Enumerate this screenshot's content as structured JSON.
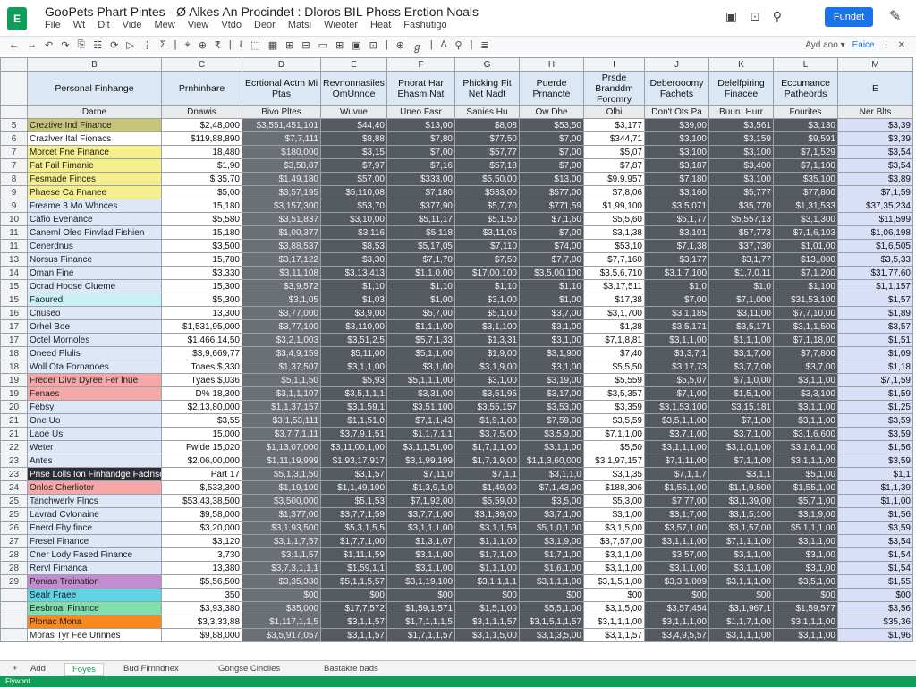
{
  "app": {
    "logo": "E",
    "title": "GooPets Phart Pintes - Ø Alkes An Procindet : Dloros BIL Phoss Erction Noals"
  },
  "menu": [
    "File",
    "Wt",
    "Dit",
    "Vide",
    "Mew",
    "View",
    "Vtdo",
    "Deor",
    "Matsi",
    "Wieoter",
    "Heat",
    "Fashutigo"
  ],
  "title_icons": [
    "comment-icon",
    "lock-icon",
    "present-icon"
  ],
  "share_label": "Fundet",
  "toolbar": {
    "items": [
      "←",
      "→",
      "↶",
      "↷",
      "⎘",
      "☷",
      "⟳",
      "▷",
      "⋮",
      "Σ",
      "|",
      "⌖",
      "⊕",
      "₹",
      "|",
      "ℓ",
      "⬚",
      "▦",
      "⊞",
      "⊟",
      "▭",
      "⊞",
      "▣",
      "⊡",
      "|",
      "⊕",
      "ℊ",
      "|",
      "∆",
      "⚲",
      "|",
      "≣"
    ],
    "right_text": "Ayd aoo ▾",
    "right_blue": "Eaice",
    "right_icons": [
      "⋮",
      "✕"
    ]
  },
  "col_letters": [
    "",
    "B",
    "C",
    "D",
    "E",
    "F",
    "G",
    "H",
    "I",
    "J",
    "K",
    "L",
    "M",
    "E"
  ],
  "cat_headers": [
    "",
    "Personal Finhange",
    "Prnhinhare",
    "Ecrtional\nActm Mi Ptas",
    "Revnonnasiles\nOmUnnoe",
    "Pnorat\nHar\nEhasm Nat",
    "Phicking Fit\nNet\nNadt",
    "Puerde\nPrnancte",
    "Prsde\nBranddm\nForomry",
    "Deberooomy\nFachets",
    "Delelfpiring\nFinacee",
    "Eccumance\nPatheords",
    "E"
  ],
  "sub_headers": [
    "",
    "Darne",
    "Dnawis",
    "Bivo Pltes",
    "Wuvue",
    "Uneo Fasr",
    "Sanies Hu",
    "Ow Dhe",
    "Olhi",
    "Don't Ots Pa",
    "Buuru Hurr",
    "Fourites",
    "Ner Blts"
  ],
  "row_numbers": [
    "5",
    "6",
    "7",
    "7",
    "8",
    "9",
    "9",
    "10",
    "11",
    "11",
    "13",
    "14",
    "15",
    "15",
    "16",
    "17",
    "17",
    "18",
    "18",
    "19",
    "19",
    "20",
    "21",
    "21",
    "22",
    "23",
    "23",
    "24",
    "25",
    "25",
    "26",
    "27",
    "28",
    "28",
    "29"
  ],
  "rows": [
    {
      "name": "Creztive Ind Finance",
      "c": "$2,48,000",
      "v": [
        "$3,551,451,101",
        "$44,40",
        "$13,00",
        "$8,08",
        "$53,50",
        "$3,177",
        "$39,00",
        "$3,561",
        "$3,130",
        "$3,39"
      ],
      "bg": "#c7c57a"
    },
    {
      "name": "Crazlver Ital Fionacs",
      "c": "$119,88,890",
      "v": [
        "$7,7,111",
        "$8,88",
        "$7,80",
        "$77,50",
        "$7,00",
        "$344,71",
        "$3,100",
        "$3,159",
        "$9,591",
        "$3,39"
      ],
      "bg": "#ffffff"
    },
    {
      "name": "Morcet Fne Finance",
      "c": "18,480",
      "v": [
        "$180,000",
        "$3,15",
        "$7,00",
        "$57,77",
        "$7,00",
        "$5,07",
        "$3,100",
        "$3,100",
        "$7,1,529",
        "$3,54"
      ],
      "bg": "#f6ef8e"
    },
    {
      "name": "Fat Fail Fimanie",
      "c": "$1,90",
      "v": [
        "$3,58,87",
        "$7,97",
        "$7,16",
        "$57,18",
        "$7,00",
        "$7,87",
        "$3,187",
        "$3,400",
        "$7,1,100",
        "$3,54"
      ],
      "bg": "#f6ef8e"
    },
    {
      "name": "Fesmade Finces",
      "c": "$,35,70",
      "v": [
        "$1,49,180",
        "$57,00",
        "$333,00",
        "$5,50,00",
        "$13,00",
        "$9,9,957",
        "$7,180",
        "$3,100",
        "$35,100",
        "$3,89"
      ],
      "bg": "#f6ef8e"
    },
    {
      "name": "Phaese Ca Fnanee",
      "c": "$5,00",
      "v": [
        "$3,57,195",
        "$5,110,08",
        "$7,180",
        "$533,00",
        "$577,00",
        "$7,8,06",
        "$3,160",
        "$5,777",
        "$77,800",
        "$7,1,59"
      ],
      "bg": "#f6ef8e"
    },
    {
      "name": "Freame 3 Mo Whnces",
      "c": "15,180",
      "v": [
        "$3,157,300",
        "$53,70",
        "$377,90",
        "$5,7,70",
        "$771,59",
        "$1,99,100",
        "$3,5,071",
        "$35,770",
        "$1,31,533",
        "$37,35,234"
      ],
      "bg": "#dde7f7"
    },
    {
      "name": "Cafio Evenance",
      "c": "$5,580",
      "v": [
        "$3,51,837",
        "$3,10,00",
        "$5,11,17",
        "$5,1,50",
        "$7,1,60",
        "$5,5,60",
        "$5,1,77",
        "$5,557,13",
        "$3,1,300",
        "$11,599"
      ],
      "bg": "#dde7f7"
    },
    {
      "name": "Caneml Oleo Finvlad Fishien",
      "c": "15,180",
      "v": [
        "$1,00,377",
        "$3,116",
        "$5,118",
        "$3,11,05",
        "$7,00",
        "$3,1,38",
        "$3,101",
        "$57,773",
        "$7,1,6,103",
        "$1,06,198"
      ],
      "bg": "#dde7f7"
    },
    {
      "name": "Cenerdnus",
      "c": "$3,500",
      "v": [
        "$3,88,537",
        "$8,53",
        "$5,17,05",
        "$7,110",
        "$74,00",
        "$53,10",
        "$7,1,38",
        "$37,730",
        "$1,01,00",
        "$1,6,505"
      ],
      "bg": "#dde7f7"
    },
    {
      "name": "Norsus Finance",
      "c": "15,780",
      "v": [
        "$3,17,122",
        "$3,30",
        "$7,1,70",
        "$7,50",
        "$7,7,00",
        "$7,7,160",
        "$3,177",
        "$3,1,77",
        "$13,,000",
        "$3,5,33"
      ],
      "bg": "#dde7f7"
    },
    {
      "name": "Oman Fine",
      "c": "$3,330",
      "v": [
        "$3,11,108",
        "$3,13,413",
        "$1,1,0,00",
        "$17,00,100",
        "$3,5,00,100",
        "$3,5,6,710",
        "$3,1,7,100",
        "$1,7,0,11",
        "$7,1,200",
        "$31,77,60"
      ],
      "bg": "#dde7f7"
    },
    {
      "name": "Ocrad Hoose Clueme",
      "c": "15,300",
      "v": [
        "$3,9,572",
        "$1,10",
        "$1,10",
        "$1,10",
        "$1,10",
        "$3,17,511",
        "$1,0",
        "$1,0",
        "$1,100",
        "$1,1,157"
      ],
      "bg": "#dde7f7"
    },
    {
      "name": "Faoured",
      "c": "$5,300",
      "v": [
        "$3,1,05",
        "$1,03",
        "$1,00",
        "$3,1,00",
        "$1,00",
        "$17,38",
        "$7,00",
        "$7,1,000",
        "$31,53,100",
        "$1,57"
      ],
      "bg": "#c9f1f5"
    },
    {
      "name": "Cnuseo",
      "c": "13,300",
      "v": [
        "$3,77,000",
        "$3,9,00",
        "$5,7,00",
        "$5,1,00",
        "$3,7,00",
        "$3,1,700",
        "$3,1,185",
        "$3,11,00",
        "$7,7,10,00",
        "$1,89"
      ],
      "bg": "#dde7f7"
    },
    {
      "name": "Orhel Boe",
      "c": "$1,531,95,000",
      "v": [
        "$3,77,100",
        "$3,110,00",
        "$1,1,1,00",
        "$3,1,100",
        "$3,1,00",
        "$1,38",
        "$3,5,171",
        "$3,5,171",
        "$3,1,1,500",
        "$3,57"
      ],
      "bg": "#dde7f7"
    },
    {
      "name": "Octel Mornoles",
      "c": "$1,466,14,50",
      "v": [
        "$3,2,1,003",
        "$3,51,2,5",
        "$5,7,1,33",
        "$1,3,31",
        "$3,1,00",
        "$7,1,8,81",
        "$3,1,1,00",
        "$1,1,1,00",
        "$7,1,18,00",
        "$1,51"
      ],
      "bg": "#dde7f7"
    },
    {
      "name": "Oneed Plulis",
      "c": "$3,9,669,77",
      "v": [
        "$3,4,9,159",
        "$5,11,00",
        "$5,1,1,00",
        "$1,9,00",
        "$3,1,900",
        "$7,40",
        "$1,3,7,1",
        "$3,1,7,00",
        "$7,7,800",
        "$1,09"
      ],
      "bg": "#dde7f7"
    },
    {
      "name": "Woll Ota Fornanoes",
      "c": "Toaes $,330",
      "v": [
        "$1,37,507",
        "$3,1,1,00",
        "$3,1,00",
        "$3,1,9,00",
        "$3,1,00",
        "$5,5,50",
        "$3,17,73",
        "$3,7,7,00",
        "$3,7,00",
        "$1,18"
      ],
      "bg": "#dde7f7"
    },
    {
      "name": "Freder Dive Dyree Fer lnue",
      "c": "Tyaes $,036",
      "v": [
        "$5,1,1,50",
        "$5,93",
        "$5,1,1,1,00",
        "$3,1,00",
        "$3,19,00",
        "$5,559",
        "$5,5,07",
        "$7,1,0,00",
        "$3,1,1,00",
        "$7,1,59"
      ],
      "bg": "#f6a7a7"
    },
    {
      "name": "Fenaes",
      "c": "D% 18,300",
      "v": [
        "$3,1,1,107",
        "$3,5,1,1,1",
        "$3,31,00",
        "$3,51,95",
        "$3,17,00",
        "$3,5,357",
        "$7,1,00",
        "$1,5,1,00",
        "$3,3,100",
        "$1,59"
      ],
      "bg": "#f6a7a7"
    },
    {
      "name": "Febsy",
      "c": "$2,13,80,000",
      "v": [
        "$1,1,37,157",
        "$3,1,59,1",
        "$3,51,100",
        "$3,55,157",
        "$3,53,00",
        "$3,359",
        "$3,1,53,100",
        "$3,15,181",
        "$3,1,1,00",
        "$1,25"
      ],
      "bg": "#dde7f7"
    },
    {
      "name": "One Uo",
      "c": "$3,55",
      "v": [
        "$3,1,53,111",
        "$1,1,51,0",
        "$7,1,1,43",
        "$1,9,1,00",
        "$7,59,00",
        "$3,5,59",
        "$3,5,1,1,00",
        "$7,1,00",
        "$3,1,1,00",
        "$3,59"
      ],
      "bg": "#dde7f7"
    },
    {
      "name": "Laoe Us",
      "c": "15,000",
      "v": [
        "$3,7,7,1,11",
        "$3,7,9,1,51",
        "$1,1,7,1,1",
        "$3,7,5,00",
        "$3,5,9,00",
        "$7,1,1,00",
        "$3,7,1,00",
        "$3,7,1,00",
        "$3,1,6,600",
        "$3,59"
      ],
      "bg": "#dde7f7"
    },
    {
      "name": "Weter",
      "c": "Fwide 15,020",
      "v": [
        "$1,13,07,000",
        "$3,11,00,1,00",
        "$3,1,1,51,00",
        "$1,7,1,1,00",
        "$3,1,1,00",
        "$5,50",
        "$3,1,1,1,00",
        "$3,1,0,1,00",
        "$3,1,6,1,00",
        "$1,56"
      ],
      "bg": "#dde7f7"
    },
    {
      "name": "Antes",
      "c": "$2,06,00,000",
      "v": [
        "$1,11,19,999",
        "$1,93,17,917",
        "$3,1,99,199",
        "$1,7,1,9,00",
        "$1,1,3,60,000",
        "$3,1,97,157",
        "$7,1,11,00",
        "$7,1,1,00",
        "$3,1,1,1,00",
        "$3,59"
      ],
      "bg": "#dde7f7"
    },
    {
      "name": "Pnse Lolls Ion Finhandge\nFaclnsers",
      "c": "Part 17",
      "v": [
        "$5,1,3,1,50",
        "$3,1,57",
        "$7,11,0",
        "$7,1,1",
        "$3,1,1,0",
        "$3,1,35",
        "$7,1,1,7",
        "$3,1,1",
        "$5,1,00",
        "$1,1"
      ],
      "bg": "#2a2d33",
      "fg": "#ffffff"
    },
    {
      "name": "Onlos Cherliotor",
      "c": "$,533,300",
      "v": [
        "$1,19,100",
        "$1,1,49,100",
        "$1,3,9,1,0",
        "$1,49,00",
        "$7,1,43,00",
        "$188,306",
        "$1,55,1,00",
        "$1,1,9,500",
        "$1,55,1,00",
        "$1,1,39"
      ],
      "bg": "#f6a7a7"
    },
    {
      "name": "Tanchwerly Flncs",
      "c": "$53,43,38,500",
      "v": [
        "$3,500,000",
        "$5,1,53",
        "$7,1,92,00",
        "$5,59,00",
        "$3,5,00",
        "$5,3,00",
        "$7,77,00",
        "$3,1,39,00",
        "$5,7,1,00",
        "$1,1,00"
      ],
      "bg": "#dde7f7"
    },
    {
      "name": "Lavrad Cvlonaine",
      "c": "$9,58,000",
      "v": [
        "$1,377,00",
        "$3,7,7,1,59",
        "$3,7,7,1,00",
        "$3,1,39,00",
        "$3,7,1,00",
        "$3,1,00",
        "$3,1,7,00",
        "$3,1,5,100",
        "$3,1,9,00",
        "$1,56"
      ],
      "bg": "#dde7f7"
    },
    {
      "name": "Enerd Fhy fince",
      "c": "$3,20,000",
      "v": [
        "$3,1,93,500",
        "$5,3,1,5,5",
        "$3,1,1,1,00",
        "$3,1,1,53",
        "$5,1,0,1,00",
        "$3,1,5,00",
        "$3,57,1,00",
        "$3,1,57,00",
        "$5,1,1,1,00",
        "$3,59"
      ],
      "bg": "#dde7f7"
    },
    {
      "name": "Fresel Finance",
      "c": "$3,120",
      "v": [
        "$3,1,1,7,57",
        "$1,7,7,1,00",
        "$1,3,1,07",
        "$1,1,1,00",
        "$3,1,9,00",
        "$3,7,57,00",
        "$3,1,1,1,00",
        "$7,1,1,1,00",
        "$3,1,1,00",
        "$3,54"
      ],
      "bg": "#dde7f7"
    },
    {
      "name": "Cner Lody Fased Finance",
      "c": "3,730",
      "v": [
        "$3,1,1,57",
        "$1,11,1,59",
        "$3,1,1,00",
        "$1,7,1,00",
        "$1,7,1,00",
        "$3,1,1,00",
        "$3,57,00",
        "$3,1,1,00",
        "$3,1,00",
        "$1,54"
      ],
      "bg": "#dde7f7"
    },
    {
      "name": "Rervl Fimanca",
      "c": "13,380",
      "v": [
        "$3,7,3,1,1,1",
        "$1,59,1,1",
        "$3,1,1,00",
        "$1,1,1,00",
        "$1,6,1,00",
        "$3,1,1,00",
        "$3,1,1,00",
        "$3,1,1,00",
        "$3,1,00",
        "$1,54"
      ],
      "bg": "#dde7f7"
    },
    {
      "name": "Ponian Traination",
      "c": "$5,56,500",
      "v": [
        "$3,35,330",
        "$5,1,1,5,57",
        "$3,1,19,100",
        "$3,1,1,1,1",
        "$3,1,1,1,00",
        "$3,1,5,1,00",
        "$3,3,1,009",
        "$3,1,1,1,00",
        "$3,5,1,00",
        "$1,55"
      ],
      "bg": "#c58bd0"
    },
    {
      "name": "Sealr Fraee",
      "c": "350",
      "v": [
        "$00",
        "$00",
        "$00",
        "$00",
        "$00",
        "$00",
        "$00",
        "$00",
        "$00",
        "$00"
      ],
      "bg": "#5fd4e3"
    },
    {
      "name": "Eesbroal Finance",
      "c": "$3,93,380",
      "v": [
        "$35,000",
        "$17,7,572",
        "$1,59,1,571",
        "$1,5,1,00",
        "$5,5,1,00",
        "$3,1,5,00",
        "$3,57,454",
        "$3,1,967,1",
        "$1,59,577",
        "$3,56"
      ],
      "bg": "#7fe0ad"
    },
    {
      "name": "Plonac Mona",
      "c": "$3,3,33,88",
      "v": [
        "$1,117,1,1,5",
        "$3,1,1,57",
        "$1,7,1,1,1,5",
        "$3,1,1,1,57",
        "$3,1,5,1,1,57",
        "$3,1,1,1,00",
        "$3,1,1,1,00",
        "$1,1,7,1,00",
        "$3,1,1,1,00",
        "$35,36"
      ],
      "bg": "#f58a1f"
    },
    {
      "name": "Moras Tyr Fee Unnnes",
      "c": "$9,88,000",
      "v": [
        "$3,5,917,057",
        "$3,1,1,57",
        "$1,7,1,1,57",
        "$3,1,1,5,00",
        "$3,1,3,5,00",
        "$3,1,1,57",
        "$3,4,9,5,57",
        "$3,1,1,1,00",
        "$3,1,1,00",
        "$1,96"
      ],
      "bg": "#ffffff"
    }
  ],
  "sheet_tabs": [
    "Add",
    "Foyes",
    "Bud Firnndnex",
    "Gongse Clnclles",
    "Bastakre bads"
  ],
  "status_text": "Flywont"
}
